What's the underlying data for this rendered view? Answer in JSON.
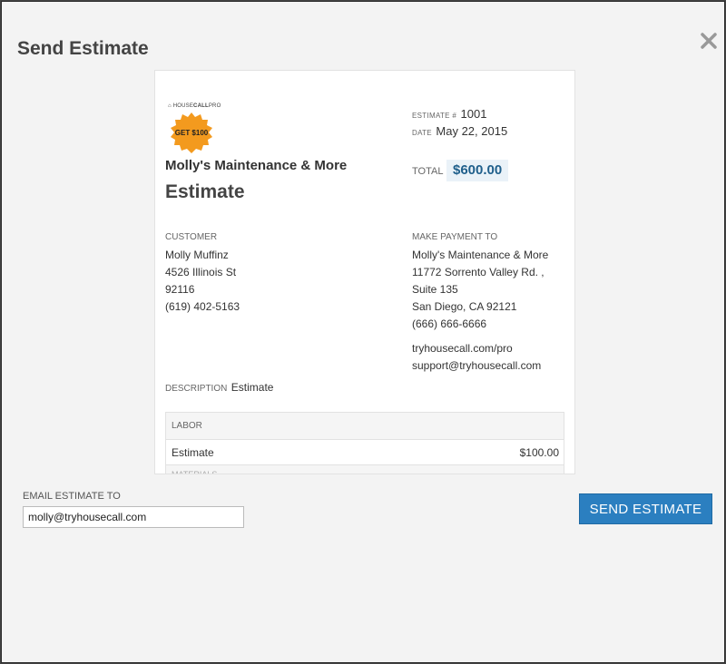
{
  "modal": {
    "title": "Send Estimate",
    "close_icon": "close-icon"
  },
  "estimate": {
    "brand_prefix": "HOUSE",
    "brand_bold": "CALL",
    "brand_suffix": "PRO",
    "badge_text": "GET $100",
    "company_name": "Molly's Maintenance & More",
    "doc_title": "Estimate",
    "estimate_label": "Estimate #",
    "estimate_number": "1001",
    "date_label": "Date",
    "date_value": "May 22, 2015",
    "total_label": "TOTAL",
    "total_value": "$600.00",
    "customer": {
      "label": "CUSTOMER",
      "name": "Molly Muffinz",
      "street": "4526 Illinois St",
      "zip": "92116",
      "phone": "(619) 402-5163"
    },
    "payment": {
      "label": "MAKE PAYMENT TO",
      "name": "Molly's Maintenance & More",
      "street": "11772 Sorrento Valley Rd. ,",
      "suite": "Suite 135",
      "city": "San Diego, CA 92121",
      "phone": "(666) 666-6666",
      "website": "tryhousecall.com/pro",
      "email": "support@tryhousecall.com"
    },
    "description_label": "DESCRIPTION",
    "description_value": "Estimate",
    "labor_header": "LABOR",
    "labor_item_name": "Estimate",
    "labor_item_amount": "$100.00",
    "next_section_partial": "MATERIALS"
  },
  "email": {
    "label": "EMAIL ESTIMATE TO",
    "value": "molly@tryhousecall.com"
  },
  "send_button": "SEND ESTIMATE",
  "colors": {
    "accent": "#2b7fc0",
    "badge": "#f39a1e",
    "total_bg": "#eaf2f8",
    "total_text": "#1f5f8b"
  }
}
